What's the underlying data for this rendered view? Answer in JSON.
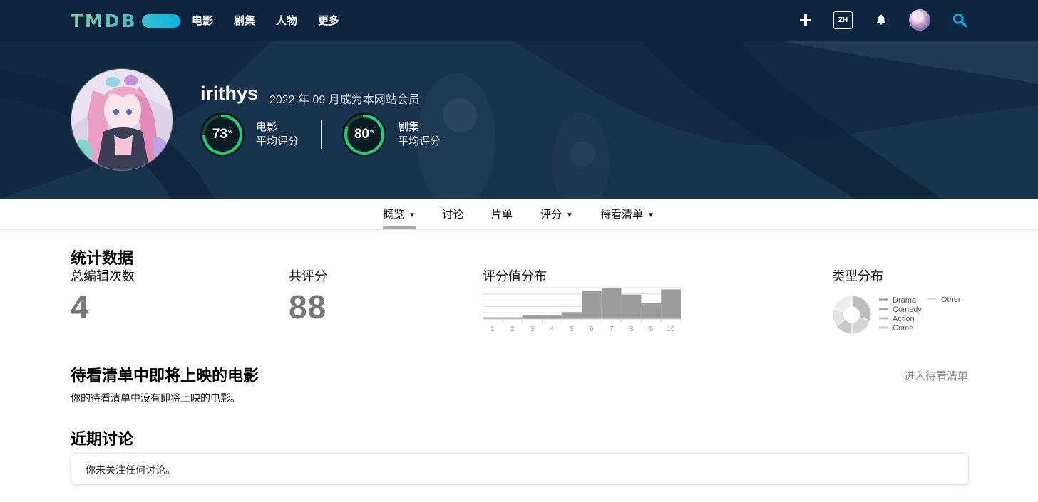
{
  "colors": {
    "nav_bg": "#0d253f",
    "logo_gradient_start": "#90cea1",
    "logo_gradient_end": "#01b4e4",
    "score_green": "#21d07a",
    "stat_value_gray": "#777777"
  },
  "nav": {
    "logo_text": "TMDB",
    "menu": [
      "电影",
      "剧集",
      "人物",
      "更多"
    ],
    "lang": "ZH",
    "icons": [
      "plus-icon",
      "bell-icon",
      "avatar",
      "search-icon"
    ]
  },
  "profile": {
    "username": "irithys",
    "member_since": "2022 年 09 月成为本网站会员",
    "movie_score": {
      "value": "73",
      "percent_sign": "%",
      "label_line1": "电影",
      "label_line2": "平均评分",
      "fraction": 0.73
    },
    "tv_score": {
      "value": "80",
      "percent_sign": "%",
      "label_line1": "剧集",
      "label_line2": "平均评分",
      "fraction": 0.8
    }
  },
  "tabs": [
    {
      "label": "概览",
      "dropdown": true,
      "active": true
    },
    {
      "label": "讨论",
      "dropdown": false,
      "active": false
    },
    {
      "label": "片单",
      "dropdown": false,
      "active": false
    },
    {
      "label": "评分",
      "dropdown": true,
      "active": false
    },
    {
      "label": "待看清单",
      "dropdown": true,
      "active": false
    }
  ],
  "stats": {
    "title": "统计数据",
    "edits_label": "总编辑次数",
    "edits_value": "4",
    "ratings_label": "共评分",
    "ratings_value": "88",
    "distribution_label": "评分值分布",
    "genre_label": "类型分布"
  },
  "chart_data": [
    {
      "type": "bar",
      "categories": [
        "1",
        "2",
        "3",
        "4",
        "5",
        "6",
        "7",
        "8",
        "9",
        "10"
      ],
      "values": [
        1,
        1,
        2,
        2,
        4,
        16,
        18,
        14,
        9,
        17
      ],
      "title": "评分值分布",
      "xlabel": "",
      "ylabel": "",
      "ylim": [
        0,
        18
      ],
      "grid": true
    },
    {
      "type": "pie",
      "title": "类型分布",
      "categories": [
        "Drama",
        "Comedy",
        "Action",
        "Crime",
        "Other"
      ],
      "values": [
        30,
        20,
        15,
        15,
        20
      ],
      "legend": "right"
    }
  ],
  "watchlist": {
    "title": "待看清单中即将上映的电影",
    "empty_text": "你的待看清单中没有即将上映的电影。",
    "link": "进入待看清单"
  },
  "discussions": {
    "title": "近期讨论",
    "empty_text": "你未关注任何讨论。"
  }
}
